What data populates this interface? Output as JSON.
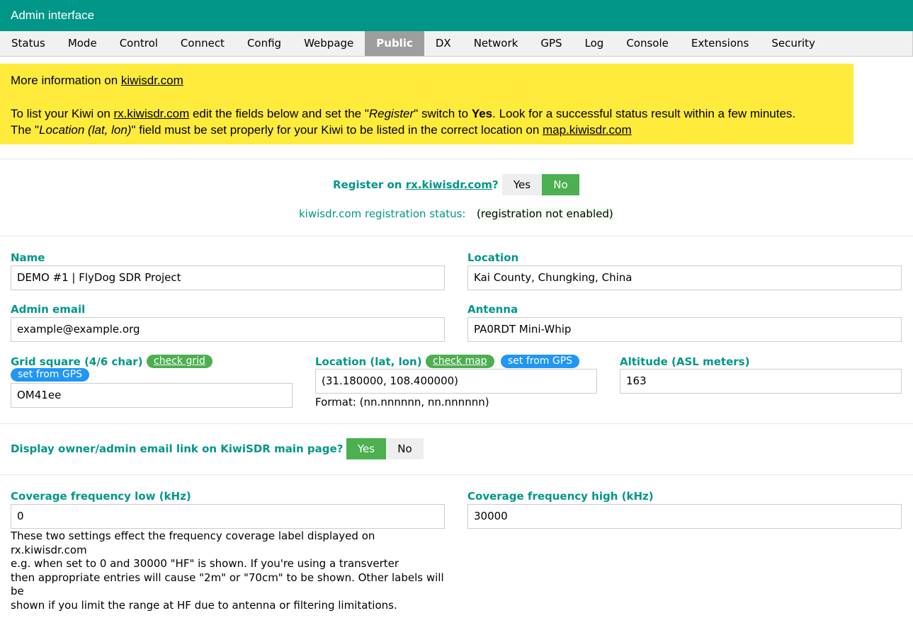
{
  "header": {
    "title": "Admin interface"
  },
  "tabs": [
    "Status",
    "Mode",
    "Control",
    "Connect",
    "Config",
    "Webpage",
    "Public",
    "DX",
    "Network",
    "GPS",
    "Log",
    "Console",
    "Extensions",
    "Security"
  ],
  "active_tab": "Public",
  "banner": {
    "line1_prefix": "More information on ",
    "line1_link": "kiwisdr.com",
    "line2_a": "To list your Kiwi on ",
    "line2_link": "rx.kiwisdr.com",
    "line2_b": " edit the fields below and set the \"",
    "line2_em": "Register",
    "line2_c": "\" switch to ",
    "line2_strong": "Yes",
    "line2_d": ". Look for a successful status result within a few minutes.",
    "line3_a": "The \"",
    "line3_em": "Location (lat, lon)",
    "line3_b": "\" field must be set properly for your Kiwi to be listed in the correct location on ",
    "line3_link": "map.kiwisdr.com"
  },
  "register": {
    "label_prefix": "Register on ",
    "label_link": "rx.kiwisdr.com",
    "label_suffix": "?",
    "yes": "Yes",
    "no": "No",
    "selected": "No",
    "status_label": "kiwisdr.com registration status:",
    "status_value": "(registration not enabled)"
  },
  "fields": {
    "name": {
      "label": "Name",
      "value": "DEMO #1 | FlyDog SDR Project"
    },
    "location": {
      "label": "Location",
      "value": "Kai County, Chungking, China"
    },
    "admin_email": {
      "label": "Admin email",
      "value": "example@example.org"
    },
    "antenna": {
      "label": "Antenna",
      "value": "PA0RDT Mini-Whip"
    },
    "grid": {
      "label": "Grid square (4/6 char)",
      "check": "check grid",
      "set_gps": "set from GPS",
      "value": "OM41ee"
    },
    "latlon": {
      "label": "Location (lat, lon)",
      "check": "check map",
      "set_gps": "set from GPS",
      "value": "(31.180000, 108.400000)",
      "format": "Format: (nn.nnnnnn, nn.nnnnnn)"
    },
    "altitude": {
      "label": "Altitude (ASL meters)",
      "value": "163"
    }
  },
  "display_email": {
    "label": "Display owner/admin email link on KiwiSDR main page?",
    "yes": "Yes",
    "no": "No",
    "selected": "Yes"
  },
  "coverage": {
    "low_label": "Coverage frequency low (kHz)",
    "low_value": "0",
    "high_label": "Coverage frequency high (kHz)",
    "high_value": "30000",
    "help": [
      "These two settings effect the frequency coverage label displayed on",
      "rx.kiwisdr.com",
      "e.g. when set to 0 and 30000 \"HF\" is shown. If you're using a transverter",
      "then appropriate entries will cause \"2m\" or \"70cm\" to be shown. Other labels will",
      "be",
      "shown if you limit the range at HF due to antenna or filtering limitations."
    ]
  },
  "colors": {
    "accent": "#009688",
    "banner": "#ffeb3b",
    "toggle_on": "#4caf50",
    "pill_blue": "#2196f3",
    "tab_active": "#9e9e9e"
  }
}
